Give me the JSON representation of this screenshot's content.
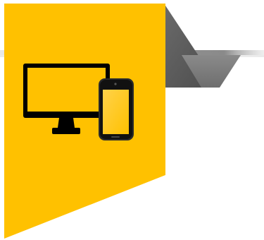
{
  "colors": {
    "background": "#ffffff",
    "banner": "#FFC100",
    "fold_dark": "#5a5a5a",
    "fold_light": "#7c7c7c",
    "divider": "#9a9a9a",
    "icon": "#000000"
  },
  "icons": {
    "monitor": "desktop-monitor-icon",
    "phone": "smartphone-icon"
  }
}
